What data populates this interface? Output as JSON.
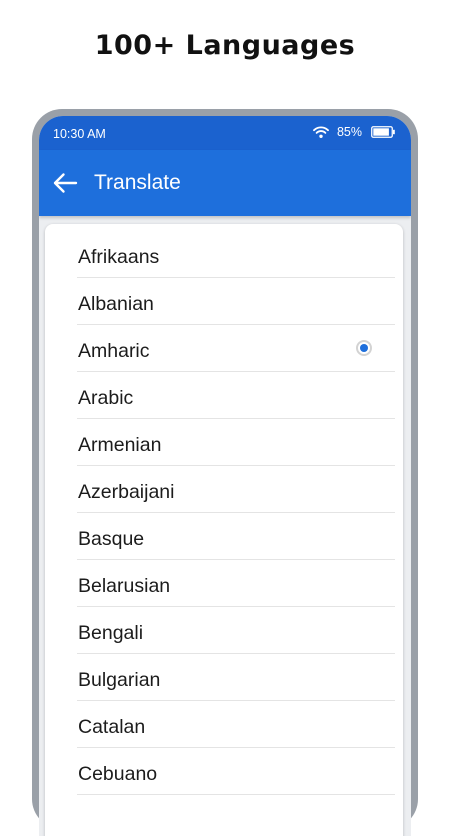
{
  "promo": {
    "headline": "100+ Languages"
  },
  "status_bar": {
    "time": "10:30 AM",
    "battery": "85%"
  },
  "app_bar": {
    "title": "Translate",
    "back_icon": "arrow-left-icon"
  },
  "languages": [
    {
      "label": "Afrikaans",
      "selected": false
    },
    {
      "label": "Albanian",
      "selected": false
    },
    {
      "label": "Amharic",
      "selected": true
    },
    {
      "label": "Arabic",
      "selected": false
    },
    {
      "label": "Armenian",
      "selected": false
    },
    {
      "label": "Azerbaijani",
      "selected": false
    },
    {
      "label": "Basque",
      "selected": false
    },
    {
      "label": "Belarusian",
      "selected": false
    },
    {
      "label": "Bengali",
      "selected": false
    },
    {
      "label": "Bulgarian",
      "selected": false
    },
    {
      "label": "Catalan",
      "selected": false
    },
    {
      "label": "Cebuano",
      "selected": false
    }
  ],
  "colors": {
    "status_bar": "#1b62cf",
    "app_bar": "#1e6fdc",
    "radio_selected": "#1e6fdc",
    "phone_frame": "#9aa0a8"
  }
}
